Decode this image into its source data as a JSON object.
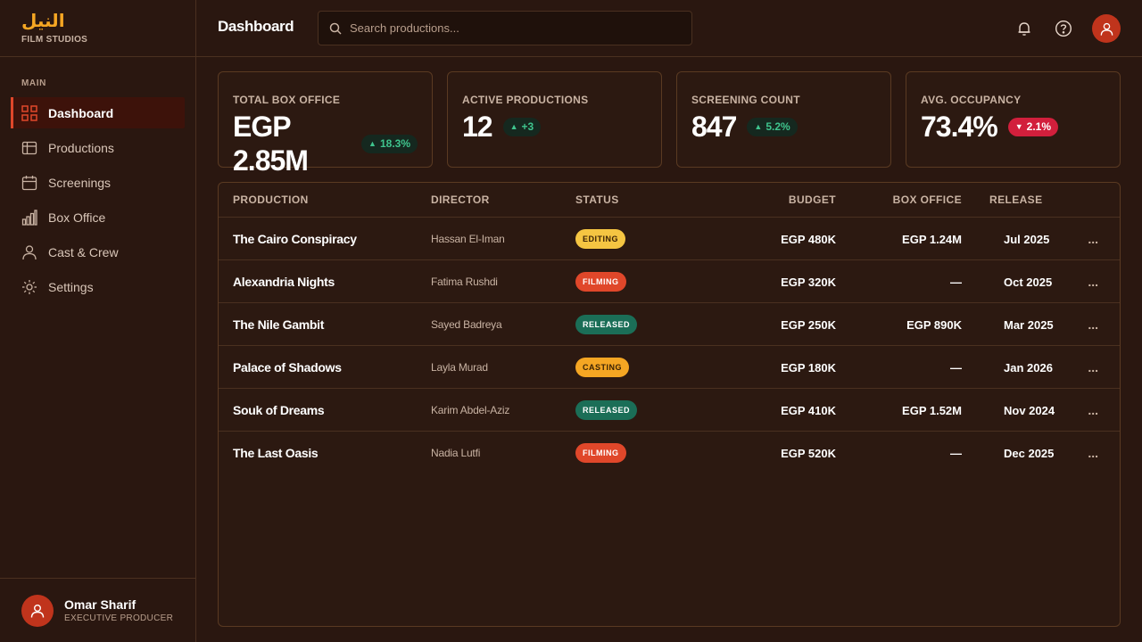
{
  "brand": {
    "logo": "النيل",
    "subtitle": "FILM STUDIOS"
  },
  "sidebar": {
    "section": "MAIN",
    "items": [
      {
        "label": "Dashboard",
        "icon": "grid-icon",
        "active": true
      },
      {
        "label": "Productions",
        "icon": "film-icon"
      },
      {
        "label": "Screenings",
        "icon": "calendar-icon"
      },
      {
        "label": "Box Office",
        "icon": "bar-chart-icon"
      },
      {
        "label": "Cast & Crew",
        "icon": "person-icon"
      },
      {
        "label": "Settings",
        "icon": "gear-icon"
      }
    ]
  },
  "user": {
    "name": "Omar Sharif",
    "role": "EXECUTIVE PRODUCER"
  },
  "header": {
    "title": "Dashboard",
    "search_placeholder": "Search productions..."
  },
  "stats": [
    {
      "label": "TOTAL BOX OFFICE",
      "value": "EGP 2.85M",
      "delta": "18.3%",
      "direction": "up"
    },
    {
      "label": "ACTIVE PRODUCTIONS",
      "value": "12",
      "delta": "+3",
      "direction": "up"
    },
    {
      "label": "SCREENING COUNT",
      "value": "847",
      "delta": "5.2%",
      "direction": "up"
    },
    {
      "label": "AVG. OCCUPANCY",
      "value": "73.4%",
      "delta": "2.1%",
      "direction": "down"
    }
  ],
  "table": {
    "columns": {
      "production": "PRODUCTION",
      "director": "DIRECTOR",
      "status": "STATUS",
      "budget": "BUDGET",
      "box_office": "BOX OFFICE",
      "release": "RELEASE"
    },
    "more_label": "...",
    "rows": [
      {
        "production": "The Cairo Conspiracy",
        "director": "Hassan El-Iman",
        "status": "EDITING",
        "budget": "EGP 480K",
        "box_office": "EGP 1.24M",
        "release": "Jul 2025"
      },
      {
        "production": "Alexandria Nights",
        "director": "Fatima Rushdi",
        "status": "FILMING",
        "budget": "EGP 320K",
        "box_office": "—",
        "release": "Oct 2025"
      },
      {
        "production": "The Nile Gambit",
        "director": "Sayed Badreya",
        "status": "RELEASED",
        "budget": "EGP 250K",
        "box_office": "EGP 890K",
        "release": "Mar 2025"
      },
      {
        "production": "Palace of Shadows",
        "director": "Layla Murad",
        "status": "CASTING",
        "budget": "EGP 180K",
        "box_office": "—",
        "release": "Jan 2026"
      },
      {
        "production": "Souk of Dreams",
        "director": "Karim Abdel-Aziz",
        "status": "RELEASED",
        "budget": "EGP 410K",
        "box_office": "EGP 1.52M",
        "release": "Nov 2024"
      },
      {
        "production": "The Last Oasis",
        "director": "Nadia Lutfi",
        "status": "FILMING",
        "budget": "EGP 520K",
        "box_office": "—",
        "release": "Dec 2025"
      }
    ]
  },
  "colors": {
    "accent": "#e0472a",
    "brand": "#f5a623",
    "positive": "#3fc48d",
    "negative": "#d21f3c"
  }
}
